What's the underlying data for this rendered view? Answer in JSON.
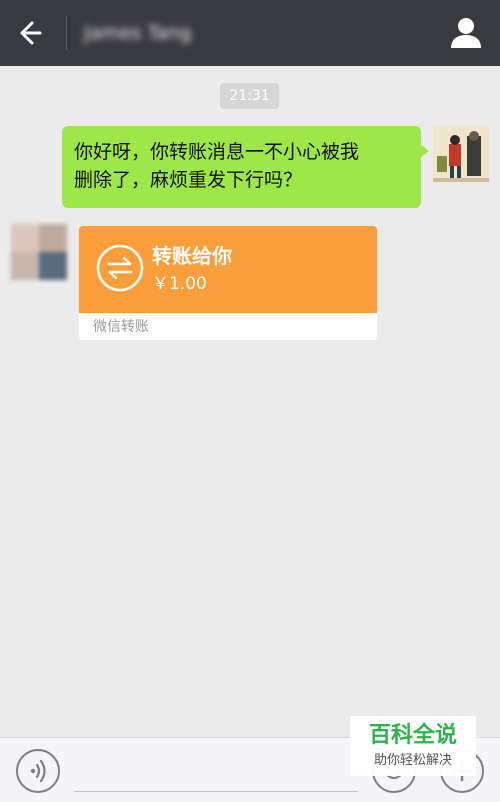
{
  "header": {
    "back_icon": "arrow-left-icon",
    "contact_name": "James Tang",
    "profile_icon": "person-icon",
    "background": "#393a3f"
  },
  "chat": {
    "timestamp": "21:31",
    "messages": [
      {
        "side": "outgoing",
        "lines": [
          "你好呀，你转账消息一不小心被我",
          "删除了，麻烦重发下行吗？"
        ],
        "bubble_color": "#9de749"
      },
      {
        "side": "incoming",
        "type": "transfer",
        "title": "转账给你",
        "amount": "￥1.00",
        "footer": "微信转账",
        "card_color": "#fa9d3b",
        "icon": "transfer-arrows-icon"
      }
    ]
  },
  "input_bar": {
    "voice_icon": "voice-icon",
    "emoji_icon": "emoji-icon",
    "more_icon": "plus-icon"
  },
  "watermark": {
    "title": "百科全说",
    "subtitle": "助你轻松解决"
  }
}
